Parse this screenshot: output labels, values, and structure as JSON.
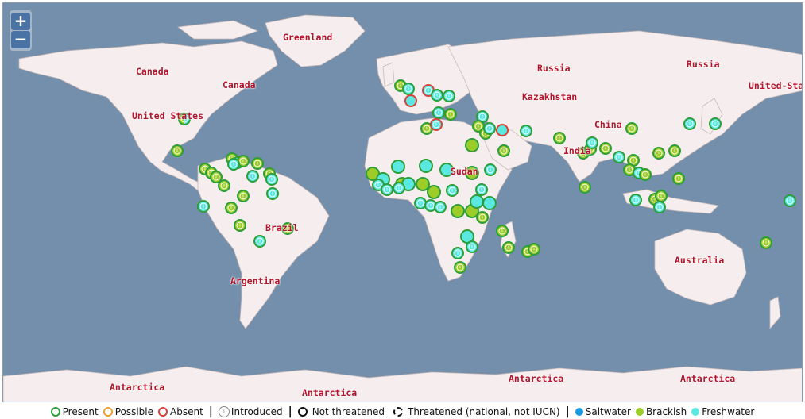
{
  "map": {
    "zoom_in_label": "+",
    "zoom_out_label": "−",
    "labels": {
      "greenland": "Greenland",
      "canada_1": "Canada",
      "canada_2": "Canada",
      "united_states_1": "United States",
      "united_states_2": "United-Sta",
      "russia_1": "Russia",
      "russia_2": "Russia",
      "kazakhstan": "Kazakhstan",
      "china": "China",
      "india": "India",
      "sudan": "Sudan",
      "brazil": "Brazil",
      "argentina": "Argentina",
      "australia": "Australia",
      "antarctica_1": "Antarctica",
      "antarctica_2": "Antarctica",
      "antarctica_3": "Antarctica",
      "antarctica_4": "Antarctica"
    },
    "colors": {
      "ocean": "#738fab",
      "land": "#f6eeee",
      "present_ring": "#2e9e3a",
      "possible_ring": "#f0a030",
      "absent_ring": "#d9403a",
      "saltwater": "#1a9be0",
      "brackish": "#9ccc28",
      "freshwater": "#5ae8e0"
    },
    "marker_count": 117
  },
  "legend": {
    "present": "Present",
    "possible": "Possible",
    "absent": "Absent",
    "introduced": "Introduced",
    "not_threatened": "Not threatened",
    "threatened": "Threatened (national, not IUCN)",
    "saltwater": "Saltwater",
    "brackish": "Brackish",
    "freshwater": "Freshwater"
  }
}
